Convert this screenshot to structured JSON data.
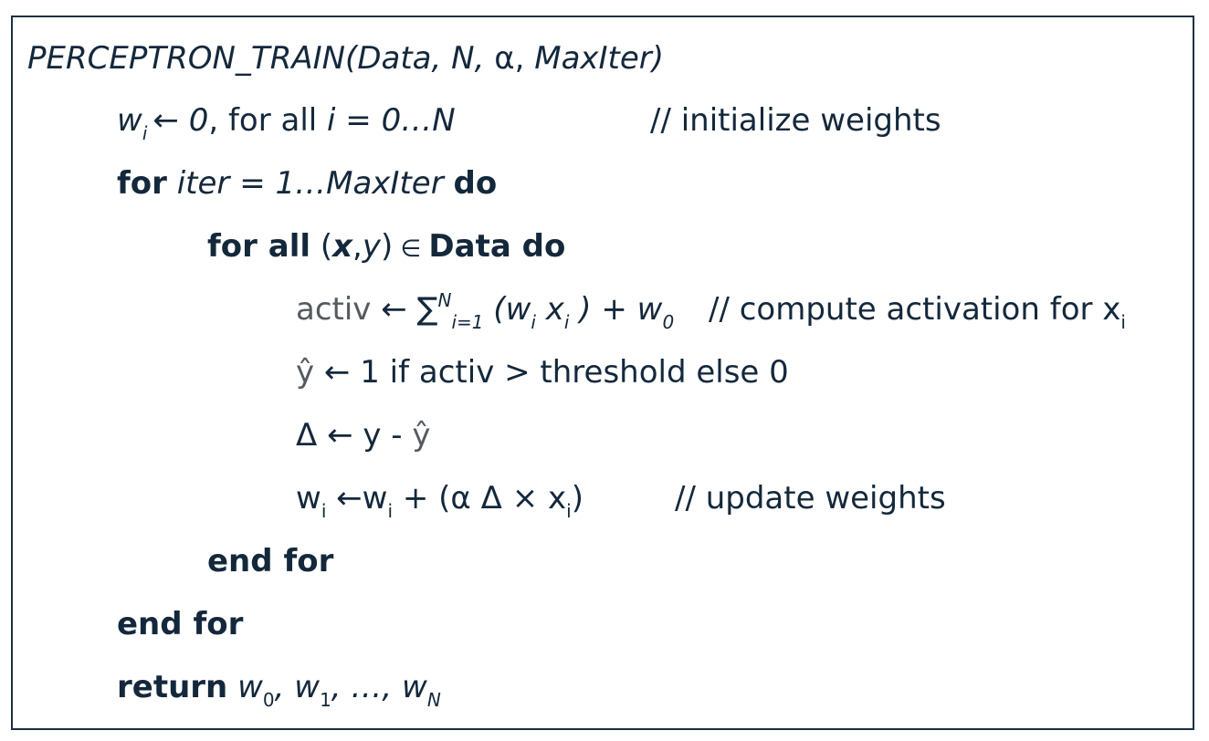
{
  "header": {
    "func_name": "PERCEPTRON_TRAIN(",
    "param_data": "Data",
    "param_n": "N",
    "param_alpha": "α",
    "param_maxiter": "MaxIter",
    "close_paren": ")",
    "sep": ", "
  },
  "init": {
    "w": "w",
    "i_sub": "i",
    "arrow": "←",
    "zero": "0",
    "for_all_text": ", for all ",
    "i": "i",
    "range": " = 0…N",
    "comment": "// initialize weights"
  },
  "outer_loop": {
    "for_kw": "for",
    "iter_expr": " iter = 1…MaxIter ",
    "do_kw": "do"
  },
  "inner_loop": {
    "for_all_kw": "for all",
    "open": " (",
    "x": "x",
    "comma": ",",
    "y": "y",
    "close": ")",
    "member": " ∈ ",
    "data_do": "Data do"
  },
  "activation": {
    "activ": "activ",
    "arrow": " ← ",
    "sum": "∑",
    "sum_sup": "N",
    "sum_sub": "i=1",
    "open": " (",
    "w": "w",
    "w_sub": "i",
    "x": " x",
    "x_sub": "i",
    "close_plus": " ) + ",
    "w0": "w",
    "w0_sub": "0",
    "comment": "// compute activation for x",
    "comment_sub": "i"
  },
  "predict": {
    "yhat": "ŷ",
    "text": " ← 1 if activ > threshold else 0"
  },
  "delta": {
    "text": "Δ ← y - ",
    "yhat": "ŷ"
  },
  "update": {
    "w": "w",
    "w_sub": "i",
    "arrow": " ←",
    "w2": "w",
    "w2_sub": "i",
    "expr": " + (α Δ ×  x",
    "x_sub": "i",
    "close": ")",
    "comment": "// update weights"
  },
  "end_inner": "end for",
  "end_outer": "end for",
  "return_line": {
    "kw": "return",
    "w": " w",
    "sub0": "0",
    "w1": ", w",
    "sub1": "1",
    "ellipsis": ", …, w",
    "subN": "N"
  }
}
